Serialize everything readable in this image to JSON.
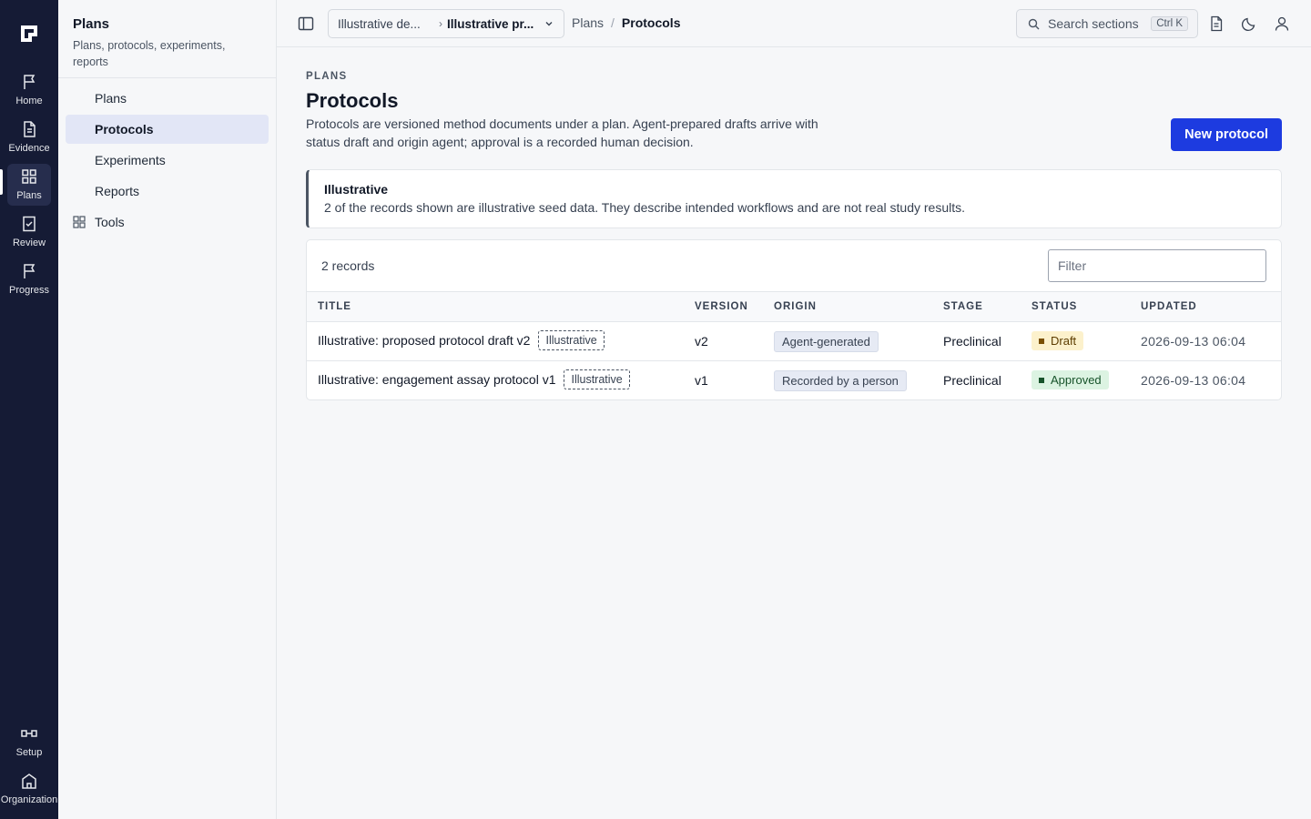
{
  "rail": {
    "items": [
      {
        "label": "Home",
        "icon": "flag-icon"
      },
      {
        "label": "Evidence",
        "icon": "document-icon"
      },
      {
        "label": "Plans",
        "icon": "grid-icon"
      },
      {
        "label": "Review",
        "icon": "checklist-icon"
      },
      {
        "label": "Progress",
        "icon": "flag-icon"
      },
      {
        "label": "Setup",
        "icon": "setup-icon"
      },
      {
        "label": "Organization",
        "icon": "building-icon"
      }
    ]
  },
  "sidebar": {
    "title": "Plans",
    "subtitle": "Plans, protocols, experiments, reports",
    "items": [
      {
        "label": "Plans"
      },
      {
        "label": "Protocols"
      },
      {
        "label": "Experiments"
      },
      {
        "label": "Reports"
      },
      {
        "label": "Tools",
        "icon": "grid-icon"
      }
    ]
  },
  "topbar": {
    "context_a": "Illustrative de...",
    "context_b": "Illustrative pr...",
    "breadcrumb": [
      "Plans",
      "Protocols"
    ],
    "breadcrumb_sep": "/",
    "search_label": "Search sections",
    "search_shortcut": "Ctrl K"
  },
  "page": {
    "eyebrow": "PLANS",
    "title": "Protocols",
    "description": "Protocols are versioned method documents under a plan. Agent-prepared drafts arrive with status draft and origin agent; approval is a recorded human decision.",
    "primary_button": "New protocol"
  },
  "notice": {
    "title": "Illustrative",
    "body": "2 of the records shown are illustrative seed data. They describe intended workflows and are not real study results."
  },
  "table": {
    "record_count": "2 records",
    "filter_placeholder": "Filter",
    "columns": [
      "TITLE",
      "VERSION",
      "ORIGIN",
      "STAGE",
      "STATUS",
      "UPDATED"
    ],
    "rows": [
      {
        "title": "Illustrative: proposed protocol draft v2",
        "tag": "Illustrative",
        "version": "v2",
        "origin": "Agent-generated",
        "stage": "Preclinical",
        "status": "Draft",
        "updated": "2026-09-13 06:04"
      },
      {
        "title": "Illustrative: engagement assay protocol v1",
        "tag": "Illustrative",
        "version": "v1",
        "origin": "Recorded by a person",
        "stage": "Preclinical",
        "status": "Approved",
        "updated": "2026-09-13 06:04"
      }
    ]
  },
  "colors": {
    "rail_bg": "#151b35",
    "accent": "#1d3be0",
    "draft": "#fcf1cc",
    "approved": "#dcf3e2"
  }
}
